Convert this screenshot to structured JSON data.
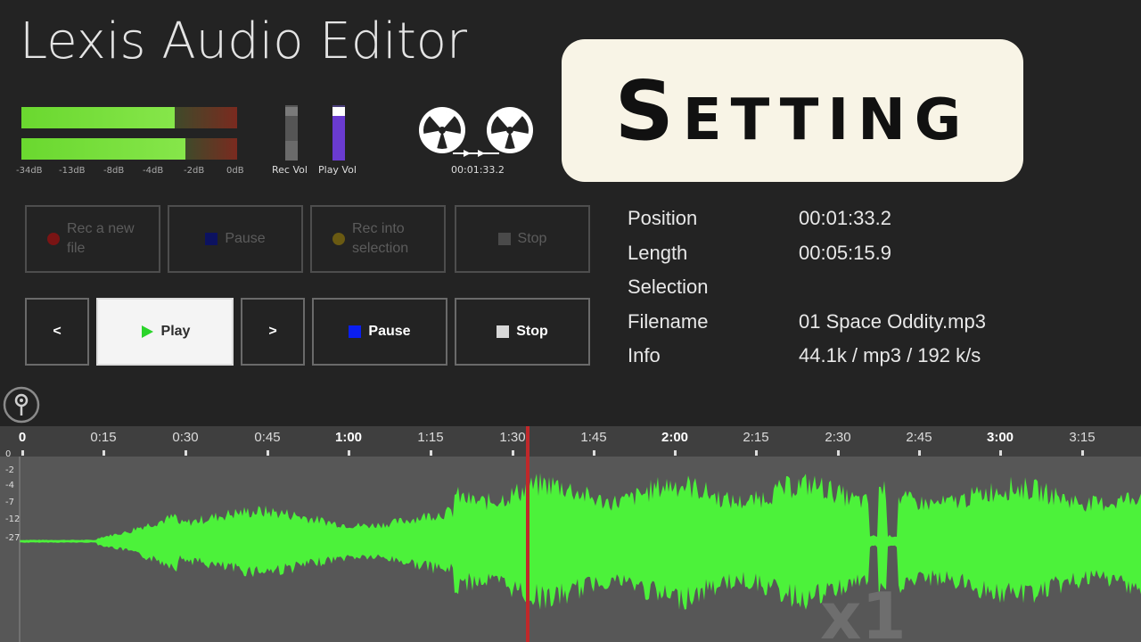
{
  "app": {
    "title": "Lexis Audio Editor"
  },
  "overlay": {
    "text": "Setting"
  },
  "meters": {
    "left_level": 0.7,
    "right_level": 0.75,
    "scale": [
      "-34dB",
      "-13dB",
      "-8dB",
      "-4dB",
      "-2dB",
      "0dB"
    ]
  },
  "volumes": {
    "rec": {
      "label": "Rec Vol",
      "level": 0.3
    },
    "play": {
      "label": "Play Vol",
      "level": 0.8
    }
  },
  "tape": {
    "time": "00:01:33.2"
  },
  "record_row": {
    "rec_new": "Rec a new file",
    "pause": "Pause",
    "rec_into": "Rec into selection",
    "stop": "Stop"
  },
  "play_row": {
    "prev": "<",
    "play": "Play",
    "next": ">",
    "pause": "Pause",
    "stop": "Stop"
  },
  "info": {
    "position_label": "Position",
    "position_value": "00:01:33.2",
    "length_label": "Length",
    "length_value": "00:05:15.9",
    "selection_label": "Selection",
    "selection_value": "",
    "filename_label": "Filename",
    "filename_value": "01 Space Oddity.mp3",
    "info_label": "Info",
    "info_value": "44.1k / mp3 / 192 k/s"
  },
  "timeline": {
    "ticks": [
      "0",
      "0:15",
      "0:30",
      "0:45",
      "1:00",
      "1:15",
      "1:30",
      "1:45",
      "2:00",
      "2:15",
      "2:30",
      "2:45",
      "3:00",
      "3:15"
    ],
    "playhead": "1:33"
  },
  "db_axis": [
    "0",
    "-2",
    "-4",
    "-7",
    "-12",
    "-27"
  ],
  "zoom": "x1",
  "colors": {
    "wave": "#4cf23a",
    "playhead": "#c0282a",
    "play_icon": "#2bd42b",
    "pause_icon": "#0a1ef0",
    "rec_dot": "#8a1515",
    "rec_into_dot": "#8a7a15",
    "play_vol": "#6a3bd0"
  }
}
